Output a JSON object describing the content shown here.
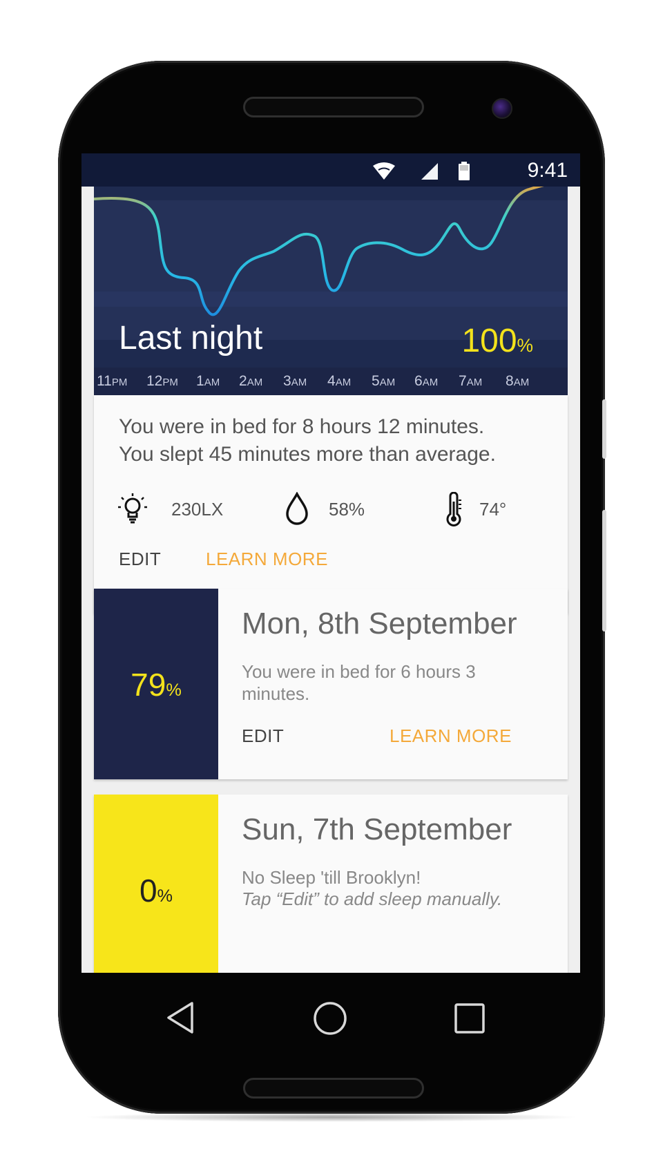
{
  "status_bar": {
    "time": "9:41"
  },
  "hero": {
    "title": "Last night",
    "score": "100",
    "score_unit": "%",
    "axis_hours": [
      {
        "num": "11",
        "suffix": "PM"
      },
      {
        "num": "12",
        "suffix": "PM"
      },
      {
        "num": "1",
        "suffix": "AM"
      },
      {
        "num": "2",
        "suffix": "AM"
      },
      {
        "num": "3",
        "suffix": "AM"
      },
      {
        "num": "4",
        "suffix": "AM"
      },
      {
        "num": "5",
        "suffix": "AM"
      },
      {
        "num": "6",
        "suffix": "AM"
      },
      {
        "num": "7",
        "suffix": "AM"
      },
      {
        "num": "8",
        "suffix": "AM"
      }
    ]
  },
  "summary": {
    "line1": "You were in bed for 8 hours 12 minutes.",
    "line2": "You slept 45 minutes more than average.",
    "light": {
      "icon": "lightbulb-icon",
      "value": "230LX"
    },
    "humidity": {
      "icon": "water-drop-icon",
      "value": "58%"
    },
    "temperature": {
      "icon": "thermometer-icon",
      "value": "74°"
    },
    "edit_label": "EDIT",
    "learn_more_label": "LEARN MORE"
  },
  "days": [
    {
      "title": "Mon, 8th September",
      "score": "79",
      "score_unit": "%",
      "desc": "You were in bed for 6 hours  3 minutes.",
      "edit_label": "EDIT",
      "learn_more_label": "LEARN MORE"
    },
    {
      "title": "Sun, 7th September",
      "score": "0",
      "score_unit": "%",
      "desc": "No Sleep 'till Brooklyn!",
      "desc_italic": "Tap “Edit” to add sleep manually."
    }
  ],
  "colors": {
    "navy": "#1e2549",
    "accent_yellow": "#f3e21c",
    "accent_orange": "#f4a93a",
    "score_card_zero": "#f7e51a"
  }
}
